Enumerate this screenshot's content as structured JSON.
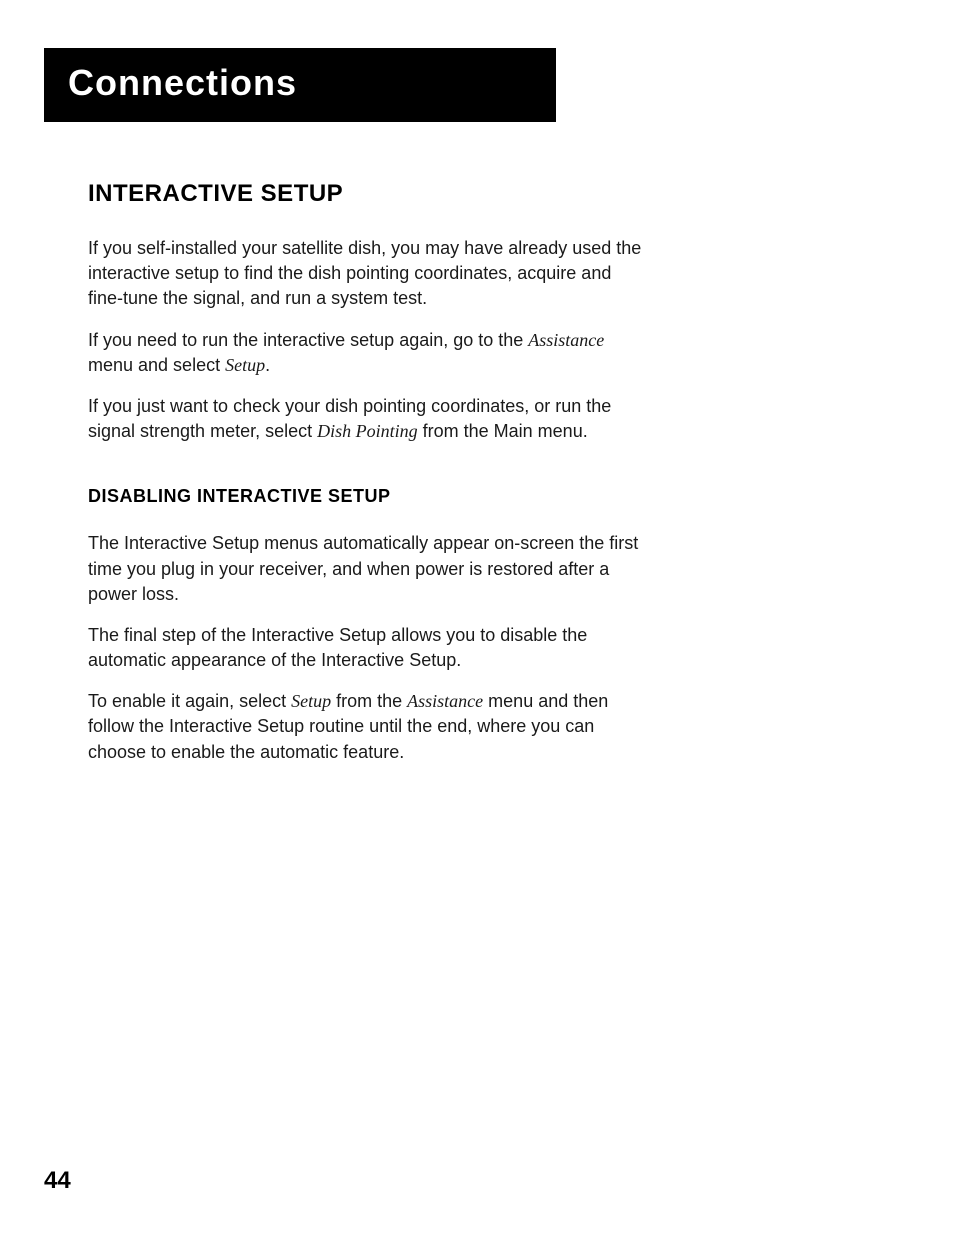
{
  "chapter": {
    "title": "Connections"
  },
  "section1": {
    "heading": "Interactive Setup",
    "para1": "If you self-installed your satellite dish, you may have already used the interactive setup to find the dish pointing coordinates, acquire and fine-tune the signal, and run a system test.",
    "para2_pre": "If you need to run the interactive setup again, go to the ",
    "para2_italic1": "Assistance",
    "para2_mid": " menu and select ",
    "para2_italic2": "Setup",
    "para2_post": ".",
    "para3_pre": "If you just want to check your dish pointing coordinates, or run the signal strength meter, select ",
    "para3_italic": "Dish Pointing",
    "para3_post": " from the Main menu."
  },
  "section2": {
    "heading": "Disabling Interactive Setup",
    "para1": "The Interactive Setup menus automatically appear on-screen the first time you plug in your receiver, and when power is restored after a power loss.",
    "para2": "The final step of the Interactive Setup allows you to disable the automatic appearance of the Interactive Setup.",
    "para3_pre": "To enable it again, select ",
    "para3_italic1": "Setup",
    "para3_mid": " from the ",
    "para3_italic2": "Assistance",
    "para3_post": " menu and then follow the Interactive Setup routine until the end, where you can choose to enable the automatic feature."
  },
  "pageNumber": "44"
}
